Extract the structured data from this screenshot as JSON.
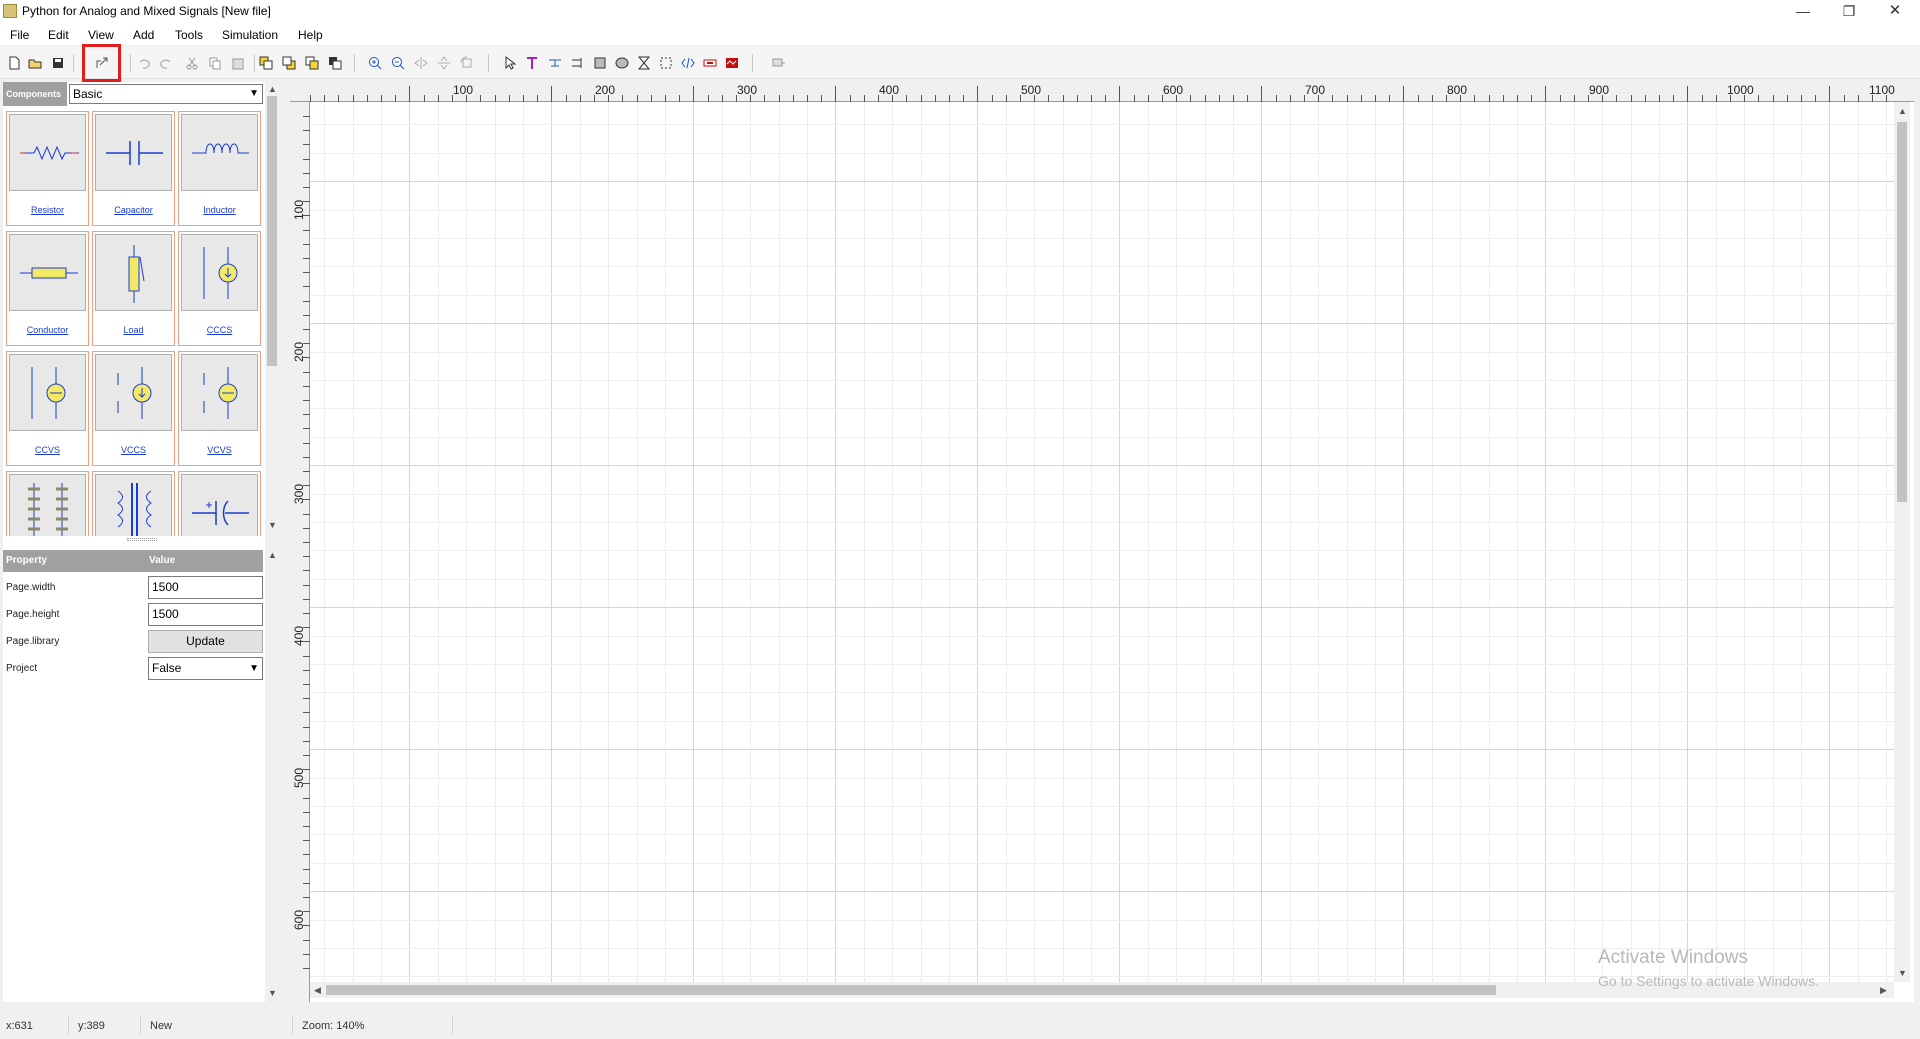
{
  "window": {
    "title": "Python for Analog and Mixed Signals [New file]",
    "min_glyph": "—",
    "max_glyph": "❐",
    "close_glyph": "✕"
  },
  "menu": [
    "File",
    "Edit",
    "View",
    "Add",
    "Tools",
    "Simulation",
    "Help"
  ],
  "toolbar": {
    "buttons": [
      {
        "name": "new-file-icon"
      },
      {
        "name": "open-file-icon"
      },
      {
        "name": "save-icon"
      },
      {
        "name": "export-icon",
        "highlighted": true
      },
      {
        "name": "undo-icon"
      },
      {
        "name": "redo-icon"
      },
      {
        "name": "cut-icon"
      },
      {
        "name": "copy-icon"
      },
      {
        "name": "paste-icon"
      },
      {
        "name": "bring-front-icon"
      },
      {
        "name": "send-back-icon"
      },
      {
        "name": "bring-forward-icon"
      },
      {
        "name": "send-backward-icon"
      },
      {
        "name": "zoom-in-icon"
      },
      {
        "name": "zoom-out-icon"
      },
      {
        "name": "flip-horizontal-icon"
      },
      {
        "name": "flip-vertical-icon"
      },
      {
        "name": "rotate-icon"
      },
      {
        "name": "select-pointer-icon"
      },
      {
        "name": "text-icon"
      },
      {
        "name": "net-label-icon"
      },
      {
        "name": "wire-icon"
      },
      {
        "name": "rectangle-icon"
      },
      {
        "name": "ellipse-icon"
      },
      {
        "name": "hourglass-icon"
      },
      {
        "name": "dashed-box-icon"
      },
      {
        "name": "code-icon"
      },
      {
        "name": "probe-icon"
      },
      {
        "name": "oscilloscope-icon"
      },
      {
        "name": "pin-icon"
      }
    ],
    "highlight_color": "#e21d1d"
  },
  "components": {
    "header": "Components",
    "library": "Basic",
    "items": [
      {
        "label": "Resistor",
        "icon": "resistor-icon"
      },
      {
        "label": "Capacitor",
        "icon": "capacitor-icon"
      },
      {
        "label": "Inductor",
        "icon": "inductor-icon"
      },
      {
        "label": "Conductor",
        "icon": "conductor-icon"
      },
      {
        "label": "Load",
        "icon": "load-icon"
      },
      {
        "label": "CCCS",
        "icon": "cccs-icon"
      },
      {
        "label": "CCVS",
        "icon": "ccvs-icon"
      },
      {
        "label": "VCCS",
        "icon": "vccs-icon"
      },
      {
        "label": "VCVS",
        "icon": "vcvs-icon"
      },
      {
        "label": "",
        "icon": "transformer-icon"
      },
      {
        "label": "",
        "icon": "transformer-core-icon"
      },
      {
        "label": "",
        "icon": "polarized-capacitor-icon"
      }
    ]
  },
  "properties": {
    "header_property": "Property",
    "header_value": "Value",
    "rows": [
      {
        "name": "Page.width",
        "value": "1500",
        "kind": "input"
      },
      {
        "name": "Page.height",
        "value": "1500",
        "kind": "input"
      },
      {
        "name": "Page.library",
        "value": "Update",
        "kind": "button"
      },
      {
        "name": "Project",
        "value": "False",
        "kind": "select"
      }
    ]
  },
  "canvas": {
    "ruler_x": [
      "100",
      "200",
      "300",
      "400",
      "500",
      "600",
      "700",
      "800",
      "900",
      "1000",
      "1100"
    ],
    "ruler_y": [
      "100",
      "200",
      "300",
      "400",
      "500",
      "600"
    ]
  },
  "watermark": {
    "line1": "Activate Windows",
    "line2": "Go to Settings to activate Windows."
  },
  "status": {
    "x": "x:631",
    "y": "y:389",
    "state": "New",
    "zoom": "Zoom: 140%"
  }
}
